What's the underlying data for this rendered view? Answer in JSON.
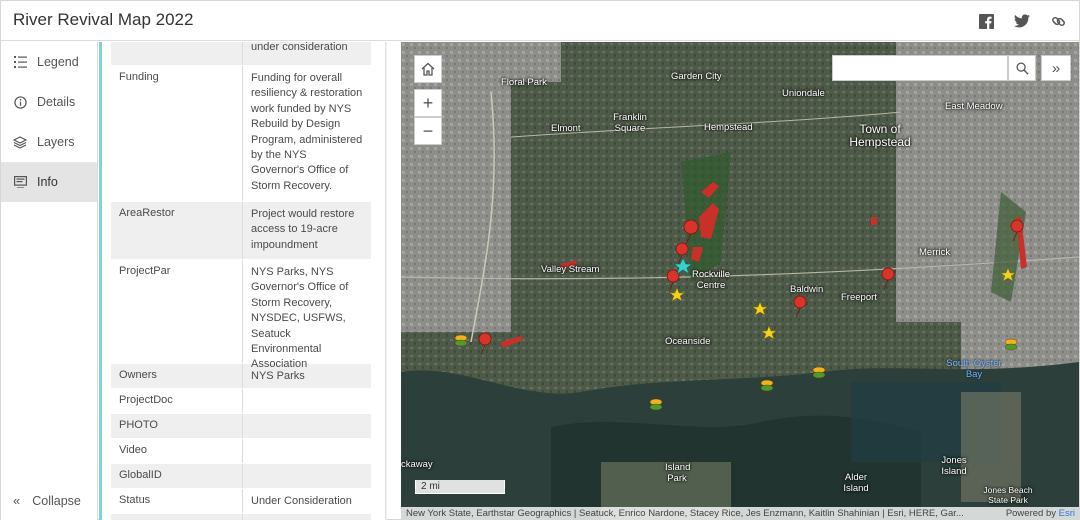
{
  "app": {
    "title": "River Revival Map 2022"
  },
  "header_icons": [
    "facebook-icon",
    "twitter-icon",
    "link-icon"
  ],
  "nav": {
    "items": [
      {
        "label": "Legend",
        "icon": "legend-icon"
      },
      {
        "label": "Details",
        "icon": "details-icon"
      },
      {
        "label": "Layers",
        "icon": "layers-icon"
      },
      {
        "label": "Info",
        "icon": "info-icon",
        "active": true
      }
    ],
    "collapse_label": "Collapse"
  },
  "info": {
    "rows": [
      {
        "name": "",
        "value": "passage currently under consideration"
      },
      {
        "name": "Funding",
        "value": "Funding for overall resiliency & restoration work funded by NYS Rebuild by Design Program, administered by the NYS Governor's Office of Storm Recovery."
      },
      {
        "name": "AreaRestor",
        "value": "Project would restore access to 19-acre impoundment"
      },
      {
        "name": "ProjectPar",
        "value": "NYS Parks, NYS Governor's Office of Storm Recovery, NYSDEC, USFWS, Seatuck Environmental Association"
      },
      {
        "name": "Owners",
        "value": "NYS Parks"
      },
      {
        "name": "ProjectDoc",
        "value": ""
      },
      {
        "name": "PHOTO",
        "value": ""
      },
      {
        "name": "Video",
        "value": ""
      },
      {
        "name": "GlobalID",
        "value": ""
      },
      {
        "name": "Status",
        "value": "Under Consideration"
      }
    ]
  },
  "map": {
    "search_placeholder": "",
    "scale_label": "2 mi",
    "attribution": "New York State, Earthstar Geographics | Seatuck, Enrico Nardone, Stacey Rice, Jes Enzmann, Kaitlin Shahinian | Esri, HERE, Gar...",
    "powered_by": "Powered by",
    "powered_brand": "Esri",
    "labels": {
      "floral_park": "Floral Park",
      "garden_city": "Garden City",
      "uniondale": "Uniondale",
      "east_meadow": "East Meadow",
      "franklin_square": "Franklin Square",
      "elmont": "Elmont",
      "hempstead": "Hempstead",
      "town_of_hempstead": "Town of Hempstead",
      "valley_stream": "Valley Stream",
      "rockville_centre": "Rockville Centre",
      "baldwin": "Baldwin",
      "freeport": "Freeport",
      "merrick": "Merrick",
      "oceanside": "Oceanside",
      "south_oyster_bay": "South Oyster Bay",
      "island_park": "Island Park",
      "alder_island": "Alder Island",
      "jones_island": "Jones Island",
      "jones_beach": "Jones Beach State Park",
      "rockaway": "ckaway"
    }
  },
  "colors": {
    "accent": "#7fd3db",
    "marker_red": "#d9342b",
    "marker_yellow": "#f2d21b",
    "water_label": "#6fb7ff"
  }
}
